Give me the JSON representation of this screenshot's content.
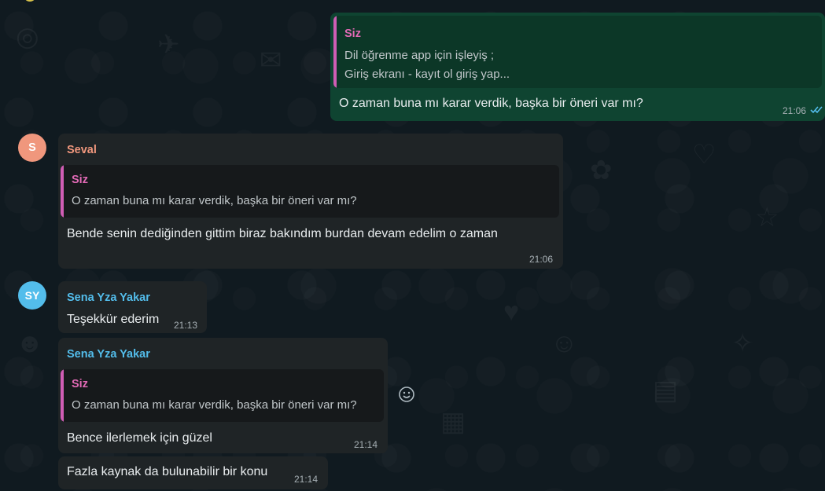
{
  "messages": {
    "m1": {
      "quote_sender": "Siz",
      "quote_line1": "Dil öğrenme app için işleyiş ;",
      "quote_line2": "Giriş ekranı - kayıt ol giriş yap...",
      "text": "O zaman buna mı karar verdik, başka bir öneri var mı?",
      "time": "21:06"
    },
    "m2": {
      "avatar": "S",
      "sender": "Seval",
      "quote_sender": "Siz",
      "quote_text": "O zaman buna mı karar verdik, başka bir öneri var mı?",
      "text": "Bende senin dediğinden gittim biraz bakındım burdan devam edelim o zaman",
      "time": "21:06"
    },
    "m3": {
      "avatar": "SY",
      "sender": "Sena Yza Yakar",
      "text": "Teşekkür ederim",
      "time": "21:13"
    },
    "m4": {
      "sender": "Sena Yza Yakar",
      "quote_sender": "Siz",
      "quote_text": "O zaman buna mı karar verdik, başka bir öneri var mı?",
      "text": "Bence ilerlemek için güzel",
      "time": "21:14"
    },
    "m5": {
      "text": "Fazla kaynak da bulunabilir bir konu",
      "time": "21:14"
    }
  },
  "colors": {
    "seval": "#f0977d",
    "sena": "#53bdeb",
    "siz_quote": "#e26ab6",
    "read_ticks": "#53bdeb"
  },
  "icons": {
    "emoji_reaction": "smiley-icon",
    "read_status": "double-check-icon"
  }
}
